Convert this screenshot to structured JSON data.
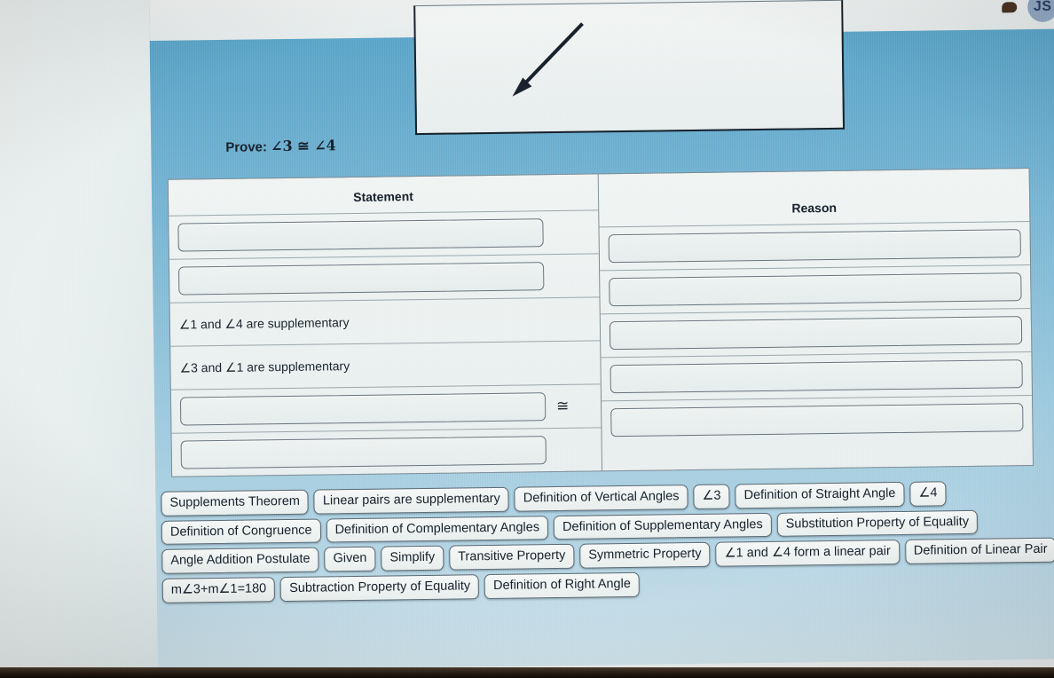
{
  "header": {
    "message_icon": "message-icon",
    "avatar_initials": "JS"
  },
  "figure": {
    "description": "geometry-figure-panel",
    "arrow_icon": "arrow-down-left-icon"
  },
  "prove": {
    "label": "Prove:",
    "expression": "∠3 ≅ ∠4"
  },
  "table": {
    "columns": [
      {
        "header": "Statement"
      },
      {
        "header": "Reason"
      }
    ],
    "statement_rows": [
      {
        "type": "dropzone",
        "text": ""
      },
      {
        "type": "dropzone",
        "text": ""
      },
      {
        "type": "text",
        "text": "∠1 and ∠4 are supplementary"
      },
      {
        "type": "text",
        "text": "∠3 and ∠1 are supplementary"
      },
      {
        "type": "dropzone",
        "text": "",
        "suffix": "≅"
      },
      {
        "type": "dropzone",
        "text": ""
      }
    ],
    "reason_rows": [
      {
        "type": "dropzone",
        "text": ""
      },
      {
        "type": "dropzone",
        "text": ""
      },
      {
        "type": "dropzone",
        "text": ""
      },
      {
        "type": "dropzone",
        "text": ""
      },
      {
        "type": "dropzone",
        "text": ""
      }
    ]
  },
  "answer_bank": {
    "chips": [
      {
        "label": "Supplements Theorem"
      },
      {
        "label": "Linear pairs are supplementary"
      },
      {
        "label": "Definition of Vertical Angles"
      },
      {
        "label": "∠3"
      },
      {
        "label": "Definition of Straight Angle"
      },
      {
        "label": "∠4"
      },
      {
        "label": "Definition of Congruence"
      },
      {
        "label": "Definition of Complementary Angles"
      },
      {
        "label": "Definition of Supplementary Angles"
      },
      {
        "label": "Substitution Property of Equality"
      },
      {
        "label": "Angle Addition Postulate"
      },
      {
        "label": "Given"
      },
      {
        "label": "Simplify"
      },
      {
        "label": "Transitive Property"
      },
      {
        "label": "Symmetric Property"
      },
      {
        "label": "∠1 and ∠4 form a linear pair"
      },
      {
        "label": "Definition of Linear Pair"
      },
      {
        "label": "m∠3+m∠1=180"
      },
      {
        "label": "Subtraction Property of Equality"
      },
      {
        "label": "Definition of Right Angle"
      }
    ]
  },
  "colors": {
    "app_background_blue": "#74b3d2",
    "panel_background": "#eef3f2",
    "text_dark": "#17212b",
    "chip_border": "#5d6a72",
    "avatar_background": "#93a8c4",
    "bezel_bottom": "#241a12",
    "band_pink": "#cf8fae"
  }
}
